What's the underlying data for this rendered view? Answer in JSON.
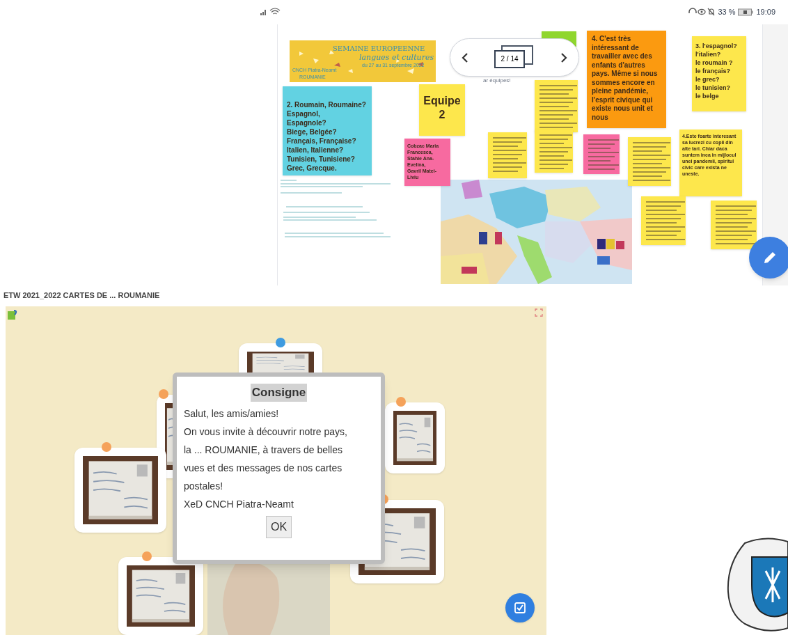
{
  "status_bar": {
    "battery": "33 %",
    "time": "19:09"
  },
  "board": {
    "banner": {
      "title": "SEMAINE EUROPEENNE",
      "subtitle": "langues et cultures",
      "dates": "du 27 au 31 septembre 2022",
      "school": "CNCH Piatra-Neamt",
      "country": "ROUMANIE"
    },
    "pager": {
      "label": "2 / 14"
    },
    "partial_text": "ar équipes!",
    "notes": [
      {
        "color": "#62d2e2",
        "text": "2. Roumain, Roumaine?\nEspagnol,\nEspagnole?\nBiege, Belgée?\nFrançais, Française?\nItalien, Italienne?\nTunisien, Tunisiene?\nGrec, Grecque."
      },
      {
        "color": "#fde74c",
        "text": "Equipe\n2"
      },
      {
        "color": "#8fd62e"
      },
      {
        "color": "#fde74c"
      },
      {
        "color": "#fb9a10",
        "text": "4. C'est très intéressant de travailler avec des enfants d'autres pays. Même si nous sommes encore en pleine pandémie, l'esprit civique qui existe nous unit et nous"
      },
      {
        "color": "#fde74c",
        "text": "3. l'espagnol?\nl'italien?\nle roumain ?\nle français?\nle grec?\nle tunisien?\nle belge"
      },
      {
        "color": "#f76aa0",
        "text": "Cobzac Maria Francesca,\nStahie Ana-Evelina,\nGavril Matei-Liviu"
      },
      {
        "color": "#fde74c"
      },
      {
        "color": "#fde74c"
      },
      {
        "color": "#f76aa0"
      },
      {
        "color": "#fde74c"
      },
      {
        "color": "#fde74c",
        "text": "4.Este foarte interesant sa lucrezi cu copii din alte tari. Chiar daca suntem inca in mijlocul unei pandemii, spiritul civic care exista ne uneste."
      },
      {
        "color": "#fde74c"
      },
      {
        "color": "#fde74c"
      }
    ]
  },
  "postcard_board": {
    "title": "ETW 2021_2022 CARTES DE ... ROUMANIE",
    "cards": [
      {
        "color": "#3f9be0"
      },
      {
        "color": "#f5a25a"
      },
      {
        "color": "#f5a25a"
      },
      {
        "color": "#f5a25a"
      },
      {
        "color": "#f5a25a"
      },
      {
        "color": "#f5a25a"
      }
    ],
    "dialog": {
      "title": "Consigne",
      "lines": [
        "Salut, les amis/amies!",
        "On vous invite à découvrir notre pays,",
        "la ... ROUMANIE, à travers de belles",
        "vues et des messages de nos cartes",
        "postales!",
        "XeD CNCH Piatra-Neamt"
      ],
      "button": "OK"
    }
  }
}
